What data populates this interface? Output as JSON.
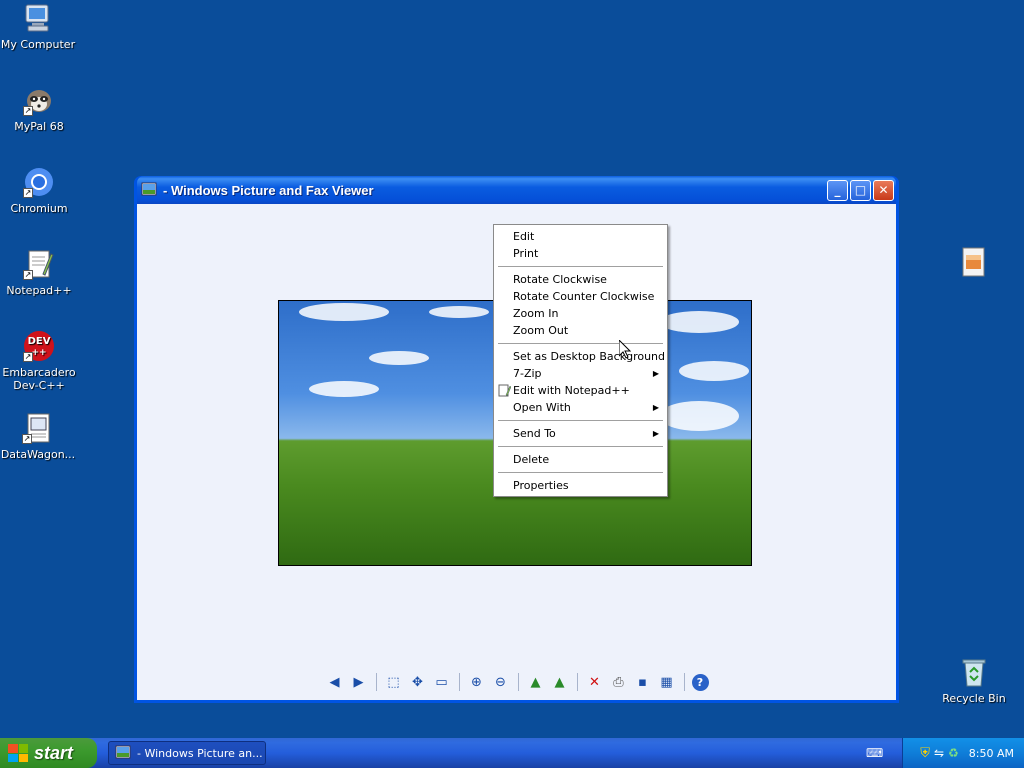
{
  "desktop": {
    "icons": [
      {
        "label": "My Computer",
        "icon": "computer-icon"
      },
      {
        "label": "MyPal 68",
        "icon": "raccoon-icon"
      },
      {
        "label": "Chromium",
        "icon": "chromium-icon"
      },
      {
        "label": "Notepad++",
        "icon": "notepad-plus-plus-icon"
      },
      {
        "label": "Embarcadero Dev-C++",
        "icon": "devcpp-icon"
      },
      {
        "label": "DataWagon...",
        "icon": "document-icon"
      },
      {
        "label": "Recycle Bin",
        "icon": "recycle-bin-icon"
      }
    ]
  },
  "window": {
    "title": "- Windows Picture and Fax Viewer",
    "controls": {
      "minimize": "_",
      "maximize": "□",
      "close": "✕"
    },
    "toolbar": [
      {
        "name": "previous-image-button",
        "glyph": "◀"
      },
      {
        "name": "next-image-button",
        "glyph": "▶"
      },
      {
        "name": "best-fit-button",
        "glyph": "⬚"
      },
      {
        "name": "actual-size-button",
        "glyph": "✥"
      },
      {
        "name": "slideshow-button",
        "glyph": "▭"
      },
      {
        "name": "zoom-in-button",
        "glyph": "⊕"
      },
      {
        "name": "zoom-out-button",
        "glyph": "⊖"
      },
      {
        "name": "rotate-clockwise-button",
        "glyph": "▲"
      },
      {
        "name": "rotate-counterclockwise-button",
        "glyph": "▲"
      },
      {
        "name": "delete-button",
        "glyph": "✕"
      },
      {
        "name": "print-button",
        "glyph": "⎙"
      },
      {
        "name": "save-button",
        "glyph": "▪"
      },
      {
        "name": "edit-button",
        "glyph": "▦"
      },
      {
        "name": "help-button",
        "glyph": "?"
      }
    ]
  },
  "context_menu": {
    "items": [
      {
        "label": "Edit"
      },
      {
        "label": "Print"
      },
      {
        "label": "Rotate Clockwise"
      },
      {
        "label": "Rotate Counter Clockwise"
      },
      {
        "label": "Zoom In"
      },
      {
        "label": "Zoom Out"
      },
      {
        "label": "Set as Desktop Background"
      },
      {
        "label": "7-Zip",
        "submenu": true
      },
      {
        "label": "Edit with Notepad++",
        "icon": "notepad-plus-plus-icon"
      },
      {
        "label": "Open With",
        "submenu": true
      },
      {
        "label": "Send To",
        "submenu": true
      },
      {
        "label": "Delete"
      },
      {
        "label": "Properties"
      }
    ]
  },
  "taskbar": {
    "start_label": "start",
    "task_label": "- Windows Picture an...",
    "clock": "8:50 AM"
  },
  "colors": {
    "desktop": "#0a4d9a",
    "titlebar": "#0054e3",
    "start_button": "#3c9a2e"
  }
}
